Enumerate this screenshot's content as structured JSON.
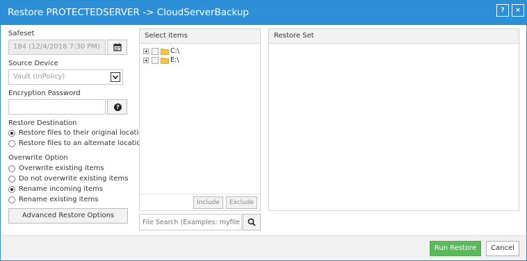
{
  "window": {
    "title": "Restore PROTECTEDSERVER -> CloudServerBackup",
    "help_label": "?",
    "close_label": "×"
  },
  "left": {
    "safeset_label": "Safeset",
    "safeset_value": "184 (12/4/2018 7:30 PM)",
    "source_device_label": "Source Device",
    "source_device_value": "Vault (InPolicy)",
    "encryption_label": "Encryption Password",
    "encryption_value": "",
    "help_glyph": "?",
    "restore_destination_label": "Restore Destination",
    "destination_options": [
      {
        "label": "Restore files to their original location",
        "checked": true
      },
      {
        "label": "Restore files to an alternate location",
        "checked": false
      }
    ],
    "overwrite_label": "Overwrite Option",
    "overwrite_options": [
      {
        "label": "Overwrite existing items",
        "checked": false
      },
      {
        "label": "Do not overwrite existing items",
        "checked": false
      },
      {
        "label": "Rename incoming items",
        "checked": true
      },
      {
        "label": "Rename existing items",
        "checked": false
      }
    ],
    "advanced_button": "Advanced Restore Options"
  },
  "select_items": {
    "title": "Select items",
    "tree": [
      {
        "label": "C:\\"
      },
      {
        "label": "E:\\"
      }
    ],
    "include_button": "Include",
    "exclude_button": "Exclude",
    "search_placeholder": "File Search (Examples: myfile.doc, *.doc)"
  },
  "restore_set": {
    "title": "Restore Set"
  },
  "footer": {
    "run_button": "Run Restore",
    "cancel_button": "Cancel"
  },
  "colors": {
    "titlebar": "#2d8fd5",
    "run_button": "#5cb85c",
    "folder": "#f6c443"
  }
}
